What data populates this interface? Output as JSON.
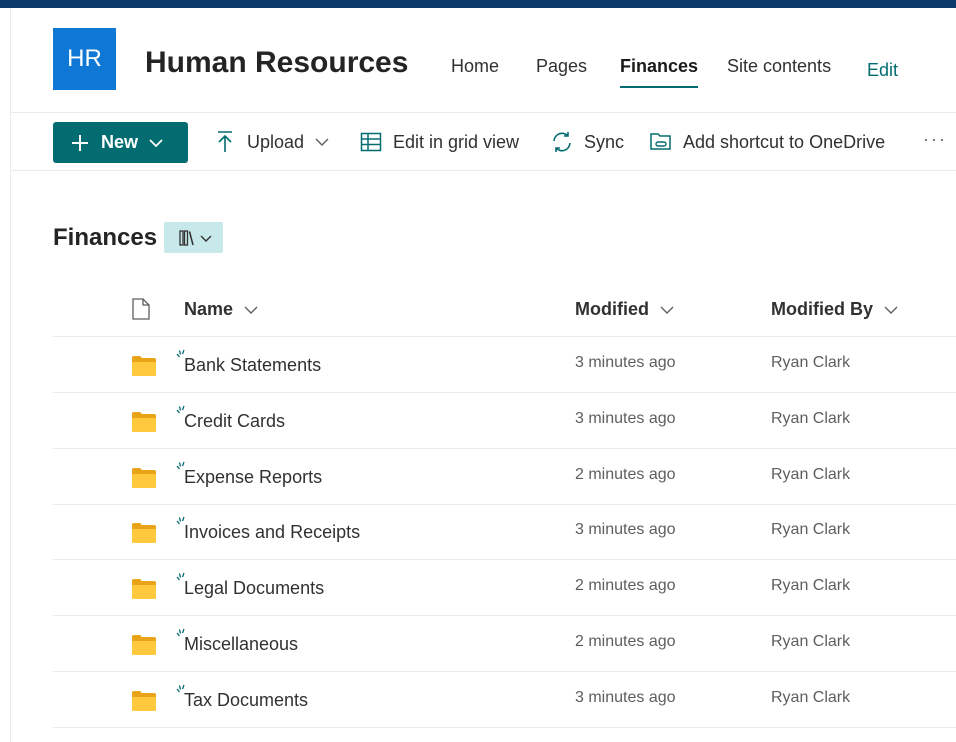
{
  "site": {
    "logo_text": "HR",
    "title": "Human Resources",
    "nav": [
      {
        "label": "Home"
      },
      {
        "label": "Pages"
      },
      {
        "label": "Finances"
      },
      {
        "label": "Site contents"
      }
    ],
    "active_nav": "Finances",
    "edit_label": "Edit"
  },
  "commands": {
    "new_label": "New",
    "upload_label": "Upload",
    "grid_label": "Edit in grid view",
    "sync_label": "Sync",
    "shortcut_label": "Add shortcut to OneDrive",
    "more_label": "···"
  },
  "library": {
    "title": "Finances"
  },
  "columns": {
    "name": "Name",
    "modified": "Modified",
    "modified_by": "Modified By"
  },
  "rows": [
    {
      "name": "Bank Statements",
      "modified": "3 minutes ago",
      "modified_by": "Ryan Clark"
    },
    {
      "name": "Credit Cards",
      "modified": "3 minutes ago",
      "modified_by": "Ryan Clark"
    },
    {
      "name": "Expense Reports",
      "modified": "2 minutes ago",
      "modified_by": "Ryan Clark"
    },
    {
      "name": "Invoices and Receipts",
      "modified": "3 minutes ago",
      "modified_by": "Ryan Clark"
    },
    {
      "name": "Legal Documents",
      "modified": "2 minutes ago",
      "modified_by": "Ryan Clark"
    },
    {
      "name": "Miscellaneous",
      "modified": "2 minutes ago",
      "modified_by": "Ryan Clark"
    },
    {
      "name": "Tax Documents",
      "modified": "3 minutes ago",
      "modified_by": "Ryan Clark"
    }
  ],
  "colors": {
    "accent": "#036c70",
    "logo": "#0f78d4",
    "topbar": "#0b3a6b",
    "folder": "#ffc83d"
  }
}
